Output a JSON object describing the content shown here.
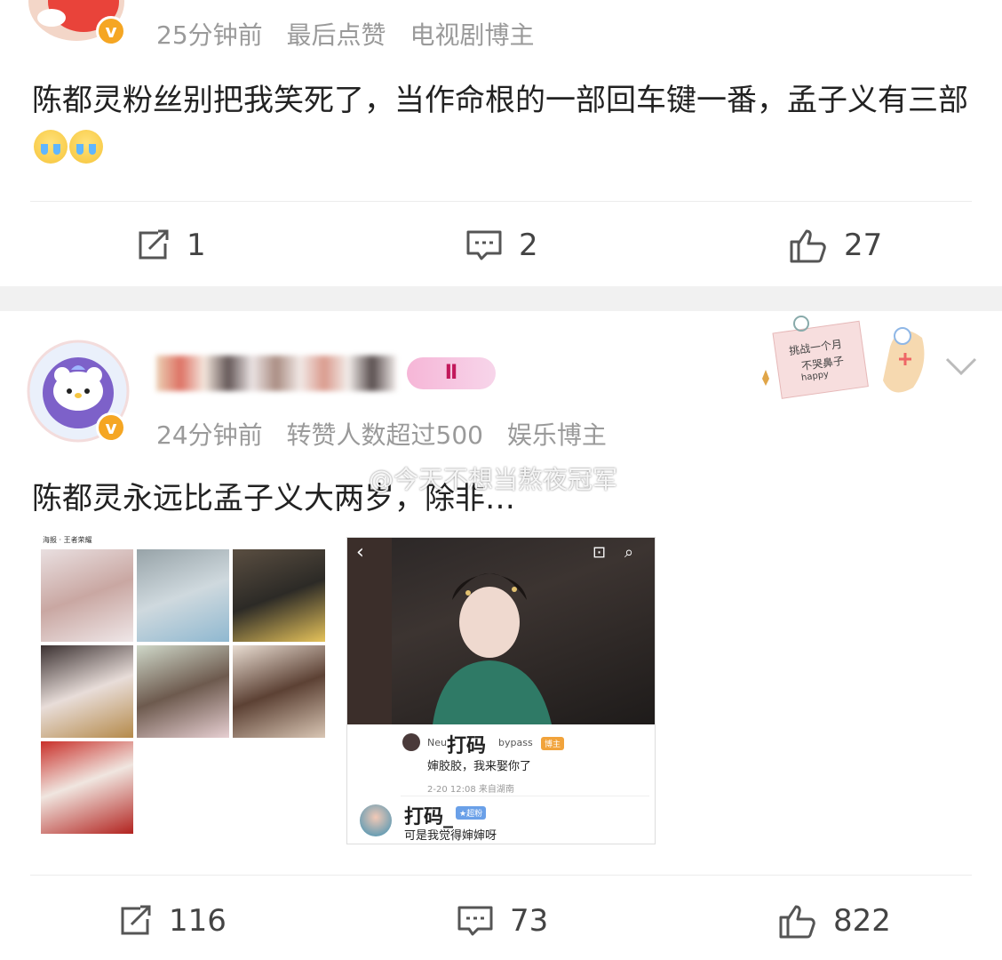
{
  "post1": {
    "meta": {
      "time": "25分钟前",
      "like_note": "最后点赞",
      "role": "电视剧博主"
    },
    "content": "陈都灵粉丝别把我笑死了，当作命根的一部回车键一番，孟子义有三部",
    "emojis": [
      "crying-emoji",
      "crying-emoji"
    ],
    "actions": {
      "repost": "1",
      "comment": "2",
      "like": "27"
    }
  },
  "post2": {
    "name_badge": "Ⅱ",
    "meta": {
      "time": "24分钟前",
      "stat": "转赞人数超过500",
      "role": "娱乐博主"
    },
    "sticker": {
      "line1": "挑战一个月",
      "line2": "不哭鼻子",
      "line3": "happy"
    },
    "content": "陈都灵永远比孟子义大两岁，除非…",
    "watermark": "@今天不想当熬夜冠军",
    "image_grid": {
      "header": "海报 · 王者荣耀"
    },
    "screenshot": {
      "comment1": {
        "name": "打码",
        "name_prefix": "Neu",
        "name_suffix": "bypass",
        "tag": "博主",
        "text": "婶胶胶，我来娶你了",
        "time": "2-20 12:08  来自湖南"
      },
      "comment2": {
        "name": "打码_",
        "tag": "★超粉",
        "text": "可是我觉得婶婶呀"
      }
    },
    "actions": {
      "repost": "116",
      "comment": "73",
      "like": "822"
    }
  },
  "colors": {
    "accent_orange": "#f5a623",
    "meta_gray": "#9a9a9a",
    "gap_gray": "#f1f1f1"
  }
}
